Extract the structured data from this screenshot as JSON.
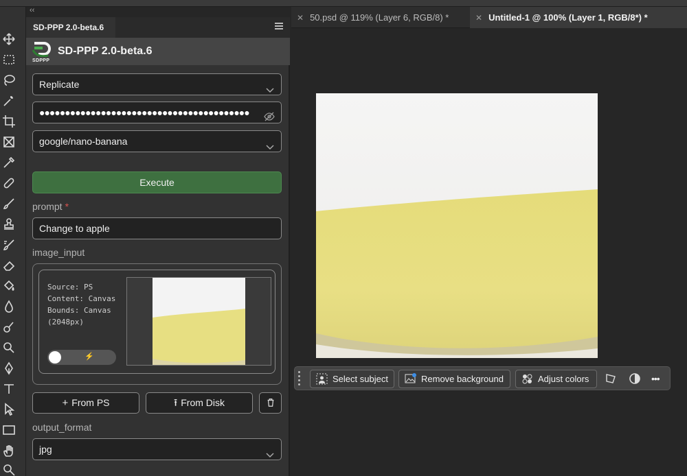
{
  "ui": {
    "collapse_label": "‹‹"
  },
  "panel": {
    "tab_title": "SD-PPP 2.0-beta.6",
    "title": "SD-PPP 2.0-beta.6",
    "logo_text": "SDPPP",
    "provider": "Replicate",
    "api_key_masked": "●●●●●●●●●●●●●●●●●●●●●●●●●●●●●●●●●●●●●●●●●",
    "model": "google/nano-banana",
    "execute_label": "Execute",
    "prompt_label": "prompt",
    "prompt_required_mark": "*",
    "prompt_value": "Change to apple",
    "image_input_label": "image_input",
    "image_meta": "Source: PS\nContent: Canvas\nBounds: Canvas\n(2048px)",
    "from_ps_label": "From PS",
    "from_disk_label": "From Disk",
    "output_format_label": "output_format",
    "output_format_value": "jpg"
  },
  "tabs": [
    {
      "label": "50.psd @ 119% (Layer 6, RGB/8) *",
      "active": false
    },
    {
      "label": "Untitled-1 @ 100% (Layer 1, RGB/8*) *",
      "active": true
    }
  ],
  "taskbar": {
    "select_subject": "Select subject",
    "remove_background": "Remove background",
    "adjust_colors": "Adjust colors",
    "more": "•••"
  },
  "colors": {
    "execute_green": "#3e7040",
    "panel_bg": "#323232",
    "canvas_bg": "#262626",
    "banana": "#e7de7e"
  },
  "icons": [
    "move-icon",
    "marquee-icon",
    "lasso-icon",
    "magic-wand-icon",
    "crop-icon",
    "frame-icon",
    "eyedropper-icon",
    "healing-brush-icon",
    "brush-icon",
    "stamp-icon",
    "history-brush-icon",
    "eraser-icon",
    "paint-bucket-icon",
    "blur-icon",
    "smudge-icon",
    "dodge-icon",
    "pen-icon",
    "type-icon",
    "path-select-icon",
    "rectangle-icon",
    "hand-icon",
    "zoom-icon"
  ]
}
